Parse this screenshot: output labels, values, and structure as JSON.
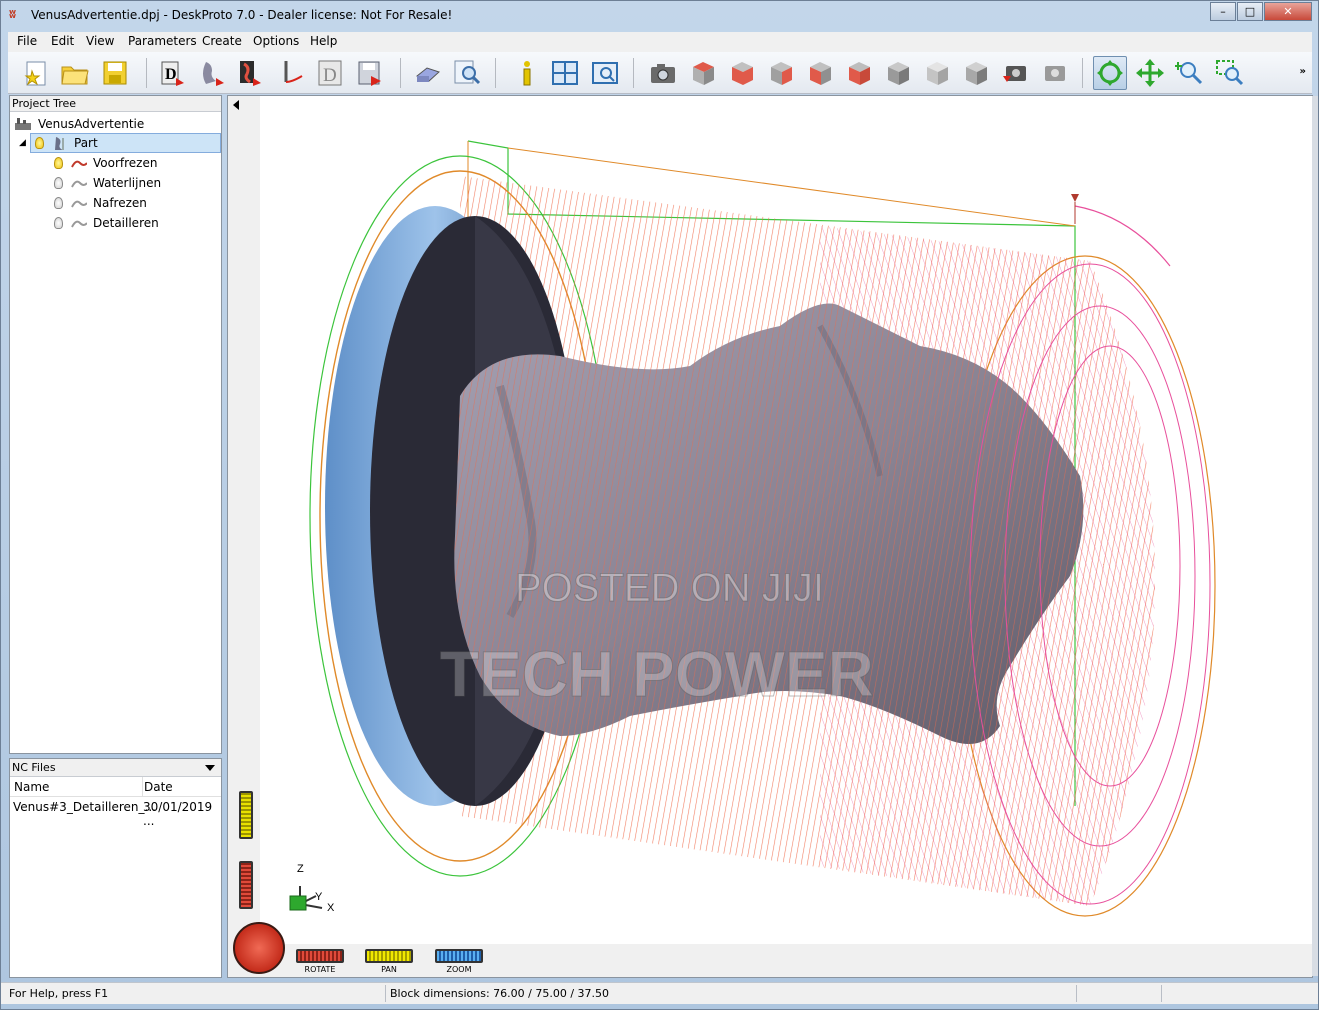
{
  "window": {
    "title": "VenusAdvertentie.dpj - DeskProto 7.0 - Dealer license: Not For Resale!",
    "app_icon": "deskproto-logo-icon",
    "controls": [
      "minimize",
      "maximize",
      "close"
    ]
  },
  "menu": {
    "items": [
      {
        "label": "File",
        "accel": "F"
      },
      {
        "label": "Edit",
        "accel": "E"
      },
      {
        "label": "View",
        "accel": "V"
      },
      {
        "label": "Parameters",
        "accel": "P"
      },
      {
        "label": "Create",
        "accel": "C"
      },
      {
        "label": "Options",
        "accel": "O"
      },
      {
        "label": "Help",
        "accel": "H"
      }
    ]
  },
  "toolbar": {
    "buttons": [
      "new-project-icon",
      "open-folder-icon",
      "save-icon",
      "project-parameters-icon",
      "part-parameters-icon",
      "operation-parameters-icon",
      "toolpath-icon",
      "dxf-icon",
      "save-nc-icon",
      "machine-icon",
      "preview-icon",
      "info-icon",
      "tile-view-icon",
      "simulation-icon",
      "camera-icon",
      "view-top-icon",
      "view-front-icon",
      "view-right-icon",
      "view-left-icon",
      "view-bottom-icon",
      "view-back-icon",
      "view-iso-icon",
      "view-shaded-icon",
      "snapshot-icon",
      "snapshot-grey-icon",
      "rotate-icon",
      "pan-icon",
      "zoom-icon",
      "zoom-window-icon"
    ],
    "active": "rotate-icon",
    "more": "»"
  },
  "project_tree": {
    "header": "Project Tree",
    "root": "VenusAdvertentie",
    "part": "Part",
    "operations": [
      {
        "label": "Voorfrezen",
        "light": "on"
      },
      {
        "label": "Waterlijnen",
        "light": "off"
      },
      {
        "label": "Nafrezen",
        "light": "off"
      },
      {
        "label": "Detailleren",
        "light": "off"
      }
    ]
  },
  "nc_files": {
    "header": "NC Files",
    "columns": [
      "Name",
      "Date"
    ],
    "rows": [
      {
        "name": "Venus#3_Detailleren_...",
        "date": "30/01/2019 ..."
      }
    ]
  },
  "viewport": {
    "watermark_line1": "POSTED ON JIJI",
    "watermark_line2": "TECH POWER",
    "axes": {
      "z": "Z",
      "y": "Y",
      "x": "X"
    },
    "colors": {
      "toolpath": "#f06a4a",
      "toolpath_pink": "#e8509c",
      "bounding_green": "#3cc43c",
      "bounding_orange": "#e08a2a",
      "model": "#8e8f9c",
      "stock": "#6a9bd0"
    }
  },
  "controls": {
    "rotate_label": "ROTATE",
    "pan_label": "PAN",
    "zoom_label": "ZOOM"
  },
  "status": {
    "help": "For Help, press F1",
    "block": "Block dimensions: 76.00 / 75.00 / 37.50"
  }
}
